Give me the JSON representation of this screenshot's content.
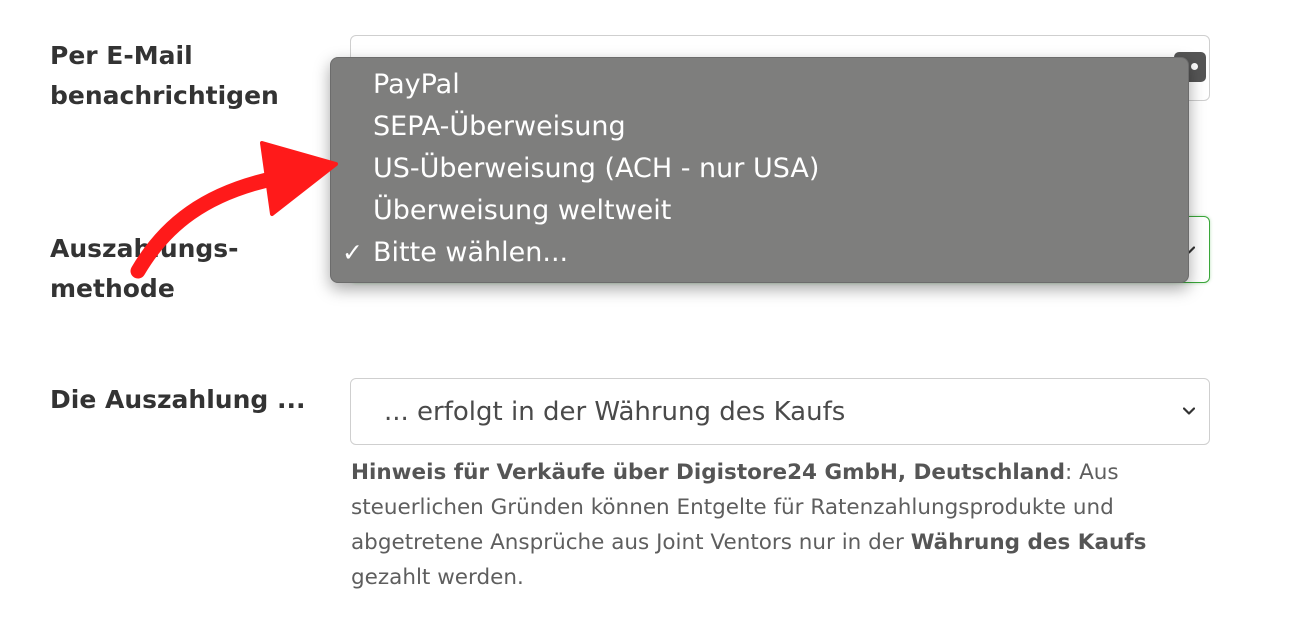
{
  "labels": {
    "email_line1": "Per E-Mail",
    "email_line2": "benachrichtigen",
    "method_line1": "Auszahlungs-",
    "method_line2": "methode",
    "payout": "Die Auszahlung ..."
  },
  "dropdown": {
    "options": [
      {
        "label": "PayPal",
        "selected": false
      },
      {
        "label": "SEPA-Überweisung",
        "selected": false
      },
      {
        "label": "US-Überweisung (ACH - nur USA)",
        "selected": false
      },
      {
        "label": "Überweisung weltweit",
        "selected": false
      },
      {
        "label": "Bitte wählen...",
        "selected": true
      }
    ],
    "check_mark": "✓"
  },
  "currency_select": {
    "value": "... erfolgt in der Währung des Kaufs"
  },
  "hint": {
    "bold_intro": "Hinweis für Verkäufe über Digistore24 GmbH, Deutschland",
    "text": ": Aus steuerlichen Gründen können Entgelte für Ratenzahlungsprodukte und abgetretene Ansprüche aus Joint Ventors nur in der ",
    "bold_end": "Währung des Kaufs",
    "text_end": " gezahlt werden."
  },
  "colors": {
    "arrow": "#ff1a1a",
    "dropdown_bg": "#7e7e7d",
    "focus_border": "#3aa63a"
  },
  "icons": {
    "email_field": "contact-card-icon",
    "selects": "chevron-down-icon"
  }
}
